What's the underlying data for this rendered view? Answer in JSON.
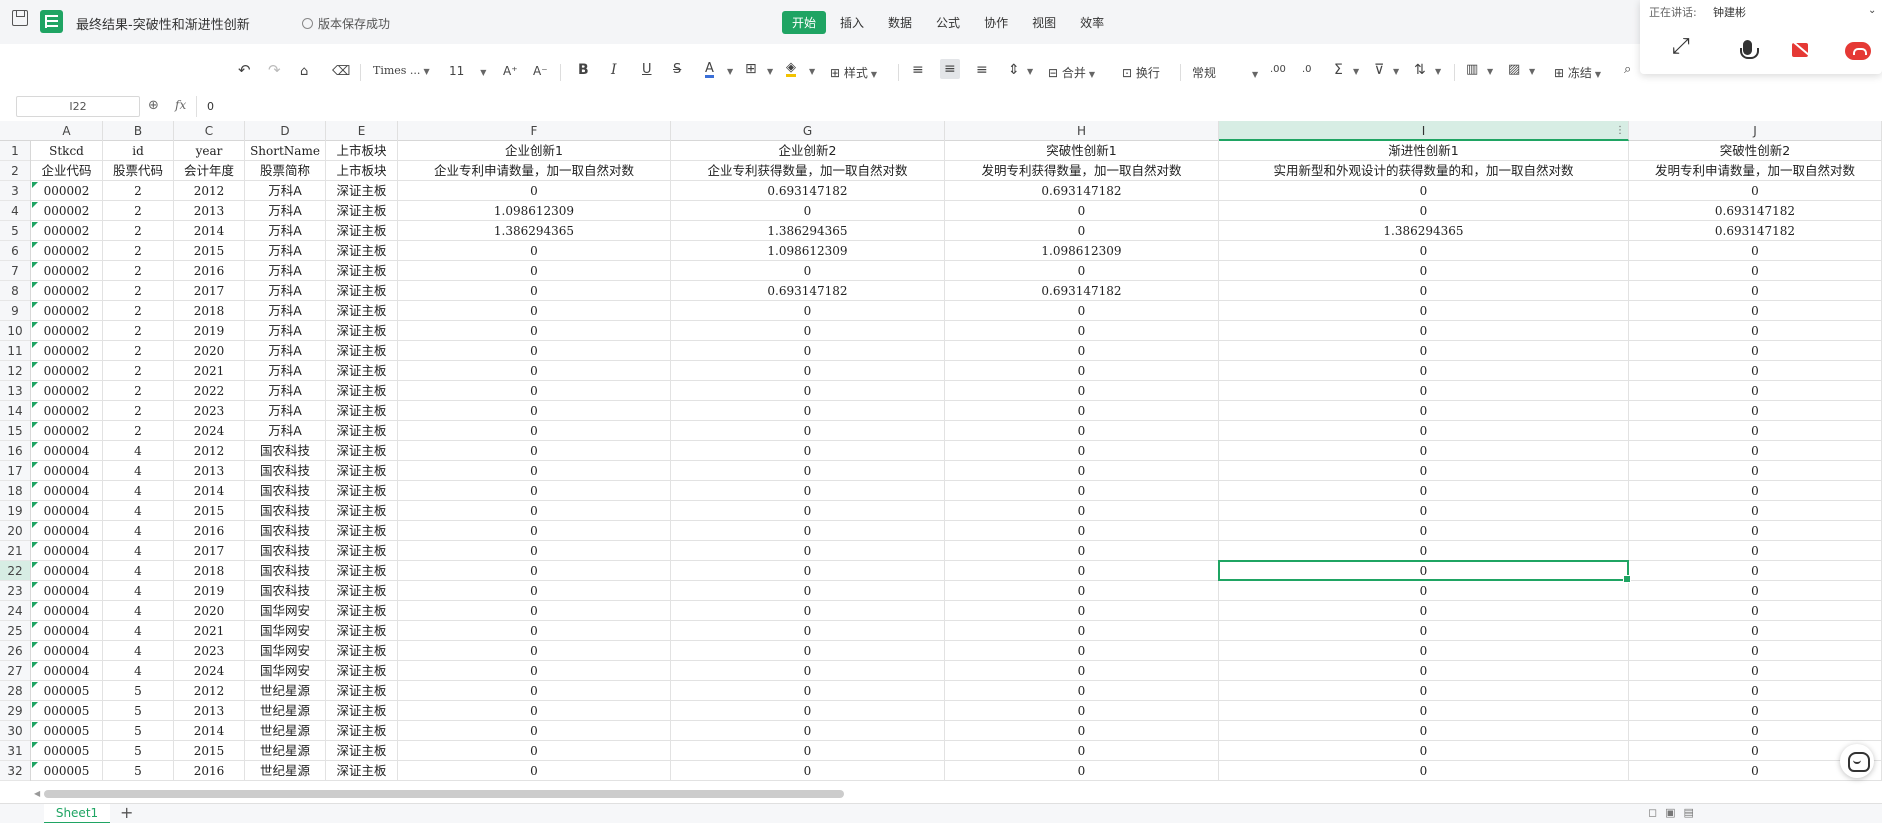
{
  "app": {
    "doc_title": "最终结果-突破性和渐进性创新",
    "save_status": "版本保存成功"
  },
  "menu": [
    {
      "label": "开始",
      "active": true
    },
    {
      "label": "插入"
    },
    {
      "label": "数据"
    },
    {
      "label": "公式"
    },
    {
      "label": "协作"
    },
    {
      "label": "视图"
    },
    {
      "label": "效率"
    }
  ],
  "call": {
    "speaking_label": "正在讲话:",
    "speaker_name": "钟建彬"
  },
  "toolbar": {
    "font_name": "Times ...",
    "font_size": "11",
    "style_label": "样式",
    "merge_label": "合并",
    "wrap_label": "换行",
    "number_format": "常规",
    "freeze_label": "冻结"
  },
  "formula": {
    "name_box": "I22",
    "value": "0"
  },
  "columns": [
    "A",
    "B",
    "C",
    "D",
    "E",
    "F",
    "G",
    "H",
    "I",
    "J"
  ],
  "selected_cell": {
    "col": "I",
    "row": 22
  },
  "rows": [
    [
      "Stkcd",
      "id",
      "year",
      "ShortName",
      "上市板块",
      "企业创新1",
      "企业创新2",
      "突破性创新1",
      "渐进性创新1",
      "突破性创新2"
    ],
    [
      "企业代码",
      "股票代码",
      "会计年度",
      "股票简称",
      "上市板块",
      "企业专利申请数量，加一取自然对数",
      "企业专利获得数量，加一取自然对数",
      "发明专利获得数量，加一取自然对数",
      "实用新型和外观设计的获得数量的和，加一取自然对数",
      "发明专利申请数量，加一取自然对数"
    ],
    [
      "000002",
      "2",
      "2012",
      "万科A",
      "深证主板",
      "0",
      "0.693147182",
      "0.693147182",
      "0",
      "0"
    ],
    [
      "000002",
      "2",
      "2013",
      "万科A",
      "深证主板",
      "1.098612309",
      "0",
      "0",
      "0",
      "0.693147182"
    ],
    [
      "000002",
      "2",
      "2014",
      "万科A",
      "深证主板",
      "1.386294365",
      "1.386294365",
      "0",
      "1.386294365",
      "0.693147182"
    ],
    [
      "000002",
      "2",
      "2015",
      "万科A",
      "深证主板",
      "0",
      "1.098612309",
      "1.098612309",
      "0",
      "0"
    ],
    [
      "000002",
      "2",
      "2016",
      "万科A",
      "深证主板",
      "0",
      "0",
      "0",
      "0",
      "0"
    ],
    [
      "000002",
      "2",
      "2017",
      "万科A",
      "深证主板",
      "0",
      "0.693147182",
      "0.693147182",
      "0",
      "0"
    ],
    [
      "000002",
      "2",
      "2018",
      "万科A",
      "深证主板",
      "0",
      "0",
      "0",
      "0",
      "0"
    ],
    [
      "000002",
      "2",
      "2019",
      "万科A",
      "深证主板",
      "0",
      "0",
      "0",
      "0",
      "0"
    ],
    [
      "000002",
      "2",
      "2020",
      "万科A",
      "深证主板",
      "0",
      "0",
      "0",
      "0",
      "0"
    ],
    [
      "000002",
      "2",
      "2021",
      "万科A",
      "深证主板",
      "0",
      "0",
      "0",
      "0",
      "0"
    ],
    [
      "000002",
      "2",
      "2022",
      "万科A",
      "深证主板",
      "0",
      "0",
      "0",
      "0",
      "0"
    ],
    [
      "000002",
      "2",
      "2023",
      "万科A",
      "深证主板",
      "0",
      "0",
      "0",
      "0",
      "0"
    ],
    [
      "000002",
      "2",
      "2024",
      "万科A",
      "深证主板",
      "0",
      "0",
      "0",
      "0",
      "0"
    ],
    [
      "000004",
      "4",
      "2012",
      "国农科技",
      "深证主板",
      "0",
      "0",
      "0",
      "0",
      "0"
    ],
    [
      "000004",
      "4",
      "2013",
      "国农科技",
      "深证主板",
      "0",
      "0",
      "0",
      "0",
      "0"
    ],
    [
      "000004",
      "4",
      "2014",
      "国农科技",
      "深证主板",
      "0",
      "0",
      "0",
      "0",
      "0"
    ],
    [
      "000004",
      "4",
      "2015",
      "国农科技",
      "深证主板",
      "0",
      "0",
      "0",
      "0",
      "0"
    ],
    [
      "000004",
      "4",
      "2016",
      "国农科技",
      "深证主板",
      "0",
      "0",
      "0",
      "0",
      "0"
    ],
    [
      "000004",
      "4",
      "2017",
      "国农科技",
      "深证主板",
      "0",
      "0",
      "0",
      "0",
      "0"
    ],
    [
      "000004",
      "4",
      "2018",
      "国农科技",
      "深证主板",
      "0",
      "0",
      "0",
      "0",
      "0"
    ],
    [
      "000004",
      "4",
      "2019",
      "国农科技",
      "深证主板",
      "0",
      "0",
      "0",
      "0",
      "0"
    ],
    [
      "000004",
      "4",
      "2020",
      "国华网安",
      "深证主板",
      "0",
      "0",
      "0",
      "0",
      "0"
    ],
    [
      "000004",
      "4",
      "2021",
      "国华网安",
      "深证主板",
      "0",
      "0",
      "0",
      "0",
      "0"
    ],
    [
      "000004",
      "4",
      "2023",
      "国华网安",
      "深证主板",
      "0",
      "0",
      "0",
      "0",
      "0"
    ],
    [
      "000004",
      "4",
      "2024",
      "国华网安",
      "深证主板",
      "0",
      "0",
      "0",
      "0",
      "0"
    ],
    [
      "000005",
      "5",
      "2012",
      "世纪星源",
      "深证主板",
      "0",
      "0",
      "0",
      "0",
      "0"
    ],
    [
      "000005",
      "5",
      "2013",
      "世纪星源",
      "深证主板",
      "0",
      "0",
      "0",
      "0",
      "0"
    ],
    [
      "000005",
      "5",
      "2014",
      "世纪星源",
      "深证主板",
      "0",
      "0",
      "0",
      "0",
      "0"
    ],
    [
      "000005",
      "5",
      "2015",
      "世纪星源",
      "深证主板",
      "0",
      "0",
      "0",
      "0",
      "0"
    ],
    [
      "000005",
      "5",
      "2016",
      "世纪星源",
      "深证主板",
      "0",
      "0",
      "0",
      "0",
      "0"
    ]
  ],
  "sheets": [
    "Sheet1"
  ],
  "colors": {
    "accent": "#1fa463",
    "danger": "#e53935"
  }
}
